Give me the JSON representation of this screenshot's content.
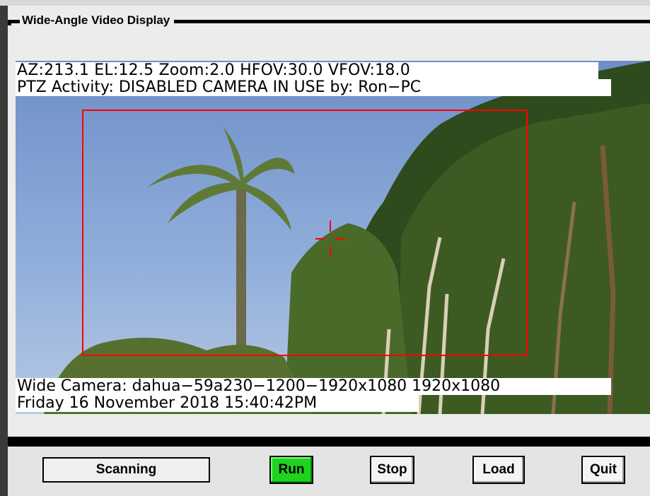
{
  "window": {
    "group_title": "Wide-Angle Video Display"
  },
  "video": {
    "overlay_line1": "AZ:213.1  EL:12.5  Zoom:2.0  HFOV:30.0  VFOV:18.0",
    "overlay_line2": "PTZ Activity: DISABLED    CAMERA IN USE by: Ron−PC",
    "overlay_line3": "Wide Camera: dahua−59a230−1200−1920x1080 1920x1080",
    "overlay_line4": "Friday 16 November 2018 15:40:42PM",
    "target_box_color": "#ff0000",
    "crosshair_color": "#ff0000"
  },
  "controls": {
    "status_text": "Scanning",
    "run_label": "Run",
    "stop_label": "Stop",
    "load_label": "Load",
    "quit_label": "Quit",
    "run_active_color": "#1fd41f"
  }
}
